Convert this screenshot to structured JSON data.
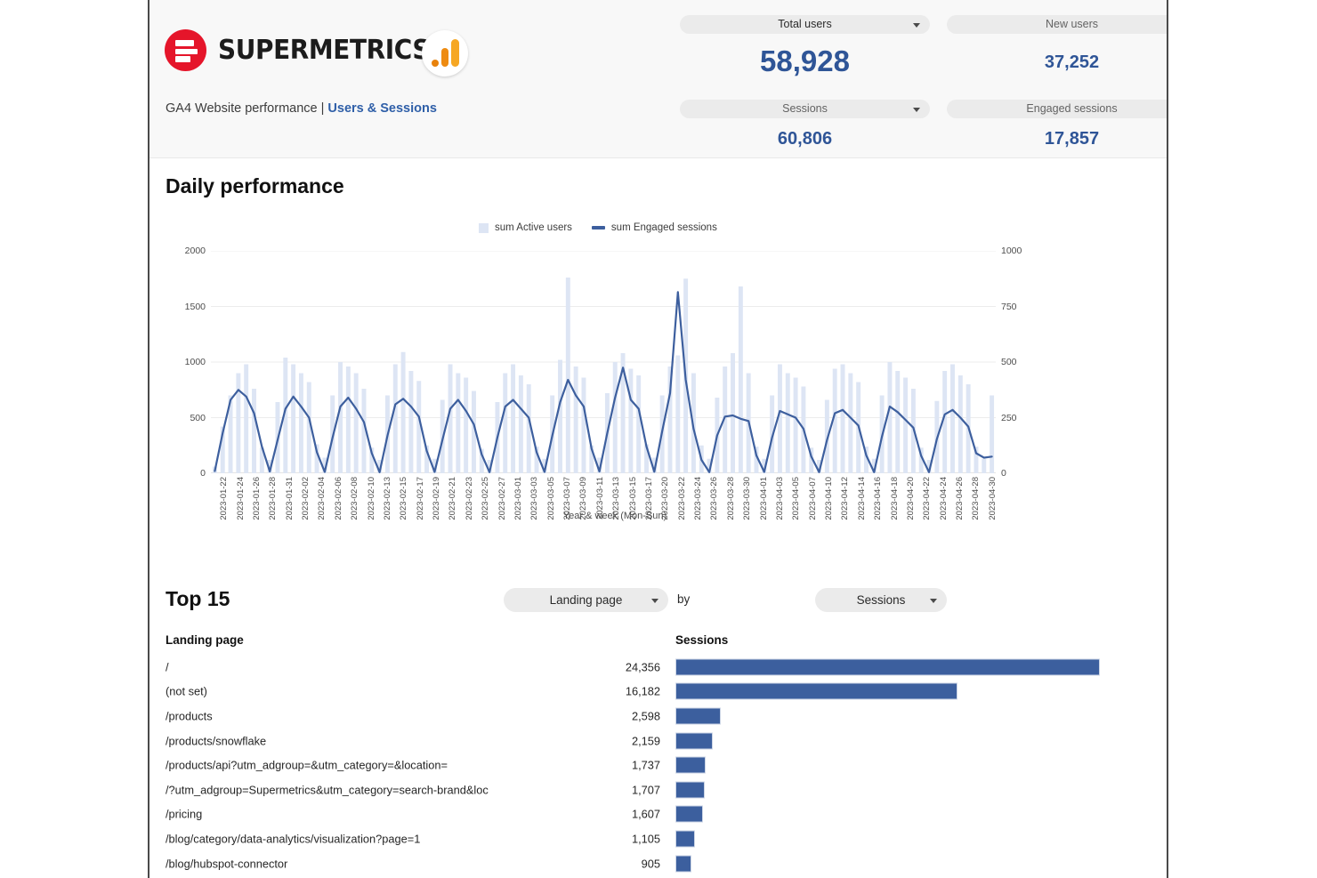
{
  "brand": {
    "wordmark": "SUPERMETRICS",
    "logo_color": "#e5152a",
    "analytics_icon_color": "#f6a723"
  },
  "header": {
    "subtitle_main": "GA4 Website performance | ",
    "subtitle_accent": "Users & Sessions",
    "accent_color": "#2f5fa8"
  },
  "kpis": [
    {
      "label": "Total users",
      "value": "58,928"
    },
    {
      "label": "New users",
      "value": "37,252"
    },
    {
      "label": "Sessions",
      "value": "60,806"
    },
    {
      "label": "Engaged sessions",
      "value": "17,857"
    }
  ],
  "kpi_value_color": "#2f5597",
  "daily": {
    "title": "Daily performance"
  },
  "top15": {
    "title": "Top 15",
    "dimension_select": "Landing page",
    "by_word": "by",
    "metric_select": "Sessions",
    "head_dimension": "Landing page",
    "head_metric": "Sessions",
    "bar_color": "#3c5f9e",
    "rows": [
      {
        "label": "/",
        "value": "24,356",
        "n": 24356
      },
      {
        "label": "(not set)",
        "value": "16,182",
        "n": 16182
      },
      {
        "label": "/products",
        "value": "2,598",
        "n": 2598
      },
      {
        "label": "/products/snowflake",
        "value": "2,159",
        "n": 2159
      },
      {
        "label": "/products/api?utm_adgroup=&utm_category=&location=",
        "value": "1,737",
        "n": 1737
      },
      {
        "label": "/?utm_adgroup=Supermetrics&utm_category=search-brand&loc",
        "value": "1,707",
        "n": 1707
      },
      {
        "label": "/pricing",
        "value": "1,607",
        "n": 1607
      },
      {
        "label": "/blog/category/data-analytics/visualization?page=1",
        "value": "1,105",
        "n": 1105
      },
      {
        "label": "/blog/hubspot-connector",
        "value": "905",
        "n": 905
      }
    ]
  },
  "chart_data": {
    "type": "bar",
    "title": "Daily performance",
    "xlabel": "Year & week (Mon-Sun)",
    "ylabel": "",
    "grid": true,
    "legend_position": "top-center",
    "ylim": [
      0,
      2000
    ],
    "y2lim": [
      0,
      1000
    ],
    "yticks": [
      0,
      500,
      1000,
      1500,
      2000
    ],
    "y2ticks": [
      0,
      250,
      500,
      750,
      1000
    ],
    "bar_color": "#dde5f4",
    "line_color": "#3d5f9e",
    "tick_labels": [
      "2023-01-22",
      "2023-01-24",
      "2023-01-26",
      "2023-01-28",
      "2023-01-31",
      "2023-02-02",
      "2023-02-04",
      "2023-02-06",
      "2023-02-08",
      "2023-02-10",
      "2023-02-13",
      "2023-02-15",
      "2023-02-17",
      "2023-02-19",
      "2023-02-21",
      "2023-02-23",
      "2023-02-25",
      "2023-02-27",
      "2023-03-01",
      "2023-03-03",
      "2023-03-05",
      "2023-03-07",
      "2023-03-09",
      "2023-03-11",
      "2023-03-13",
      "2023-03-15",
      "2023-03-17",
      "2023-03-20",
      "2023-03-22",
      "2023-03-24",
      "2023-03-26",
      "2023-03-28",
      "2023-03-30",
      "2023-04-01",
      "2023-04-03",
      "2023-04-05",
      "2023-04-07",
      "2023-04-10",
      "2023-04-12",
      "2023-04-14",
      "2023-04-16",
      "2023-04-18",
      "2023-04-20",
      "2023-04-22",
      "2023-04-24",
      "2023-04-26",
      "2023-04-28",
      "2023-04-30"
    ],
    "series": [
      {
        "name": "sum Active users",
        "type": "bar",
        "axis": "left",
        "values": [
          60,
          420,
          700,
          900,
          980,
          760,
          230,
          120,
          640,
          1040,
          980,
          900,
          820,
          260,
          140,
          700,
          1000,
          960,
          900,
          760,
          230,
          120,
          700,
          980,
          1090,
          920,
          830,
          250,
          130,
          660,
          980,
          900,
          860,
          740,
          220,
          120,
          640,
          900,
          980,
          880,
          800,
          240,
          130,
          700,
          1020,
          1760,
          960,
          860,
          250,
          140,
          720,
          1000,
          1080,
          940,
          880,
          260,
          140,
          700,
          960,
          1060,
          1750,
          900,
          250,
          130,
          680,
          960,
          1080,
          1680,
          900,
          240,
          130,
          700,
          980,
          900,
          860,
          780,
          230,
          120,
          660,
          940,
          980,
          900,
          820,
          240,
          130,
          700,
          1000,
          920,
          860,
          760,
          230,
          120,
          650,
          920,
          980,
          880,
          800,
          240,
          130,
          700
        ]
      },
      {
        "name": "sum Engaged sessions",
        "type": "line",
        "axis": "right",
        "values": [
          10,
          180,
          330,
          375,
          345,
          270,
          120,
          8,
          150,
          290,
          345,
          300,
          250,
          95,
          6,
          160,
          300,
          340,
          290,
          230,
          90,
          5,
          170,
          310,
          335,
          300,
          255,
          100,
          6,
          150,
          290,
          330,
          280,
          220,
          85,
          5,
          160,
          300,
          330,
          290,
          250,
          95,
          6,
          170,
          320,
          420,
          350,
          300,
          110,
          8,
          180,
          340,
          475,
          330,
          290,
          120,
          7,
          190,
          360,
          815,
          420,
          200,
          60,
          5,
          170,
          255,
          260,
          245,
          235,
          80,
          6,
          160,
          280,
          265,
          250,
          200,
          75,
          5,
          150,
          270,
          285,
          250,
          215,
          80,
          5,
          165,
          300,
          275,
          240,
          205,
          78,
          5,
          155,
          265,
          285,
          250,
          210,
          90,
          70,
          75
        ]
      }
    ]
  }
}
